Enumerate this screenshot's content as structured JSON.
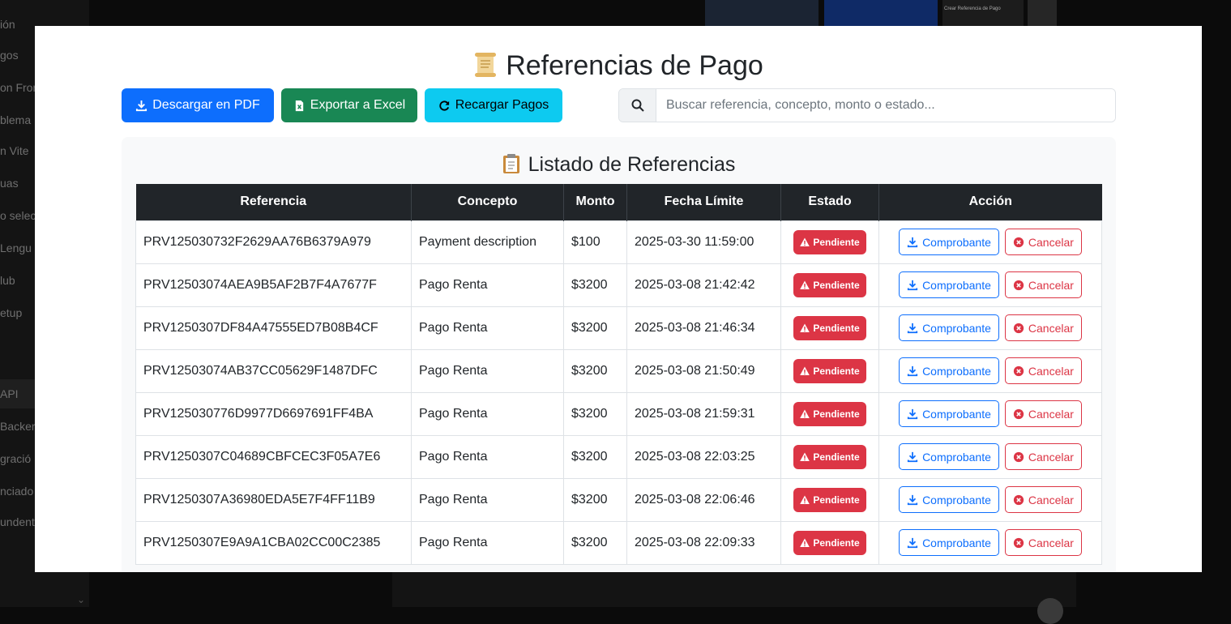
{
  "background": {
    "sidebar_items": [
      "ión",
      "gos",
      "on Fron",
      "blema",
      "n Vite",
      "uas",
      "o selec",
      "Lengu",
      "lub",
      "etup",
      "API",
      "Backer",
      "gració",
      "nciado",
      "undent"
    ],
    "thumb_text": "Crear Referencia de Pago"
  },
  "modal": {
    "title": "Referencias de Pago",
    "toolbar": {
      "pdf_label": "Descargar en PDF",
      "excel_label": "Exportar a Excel",
      "reload_label": "Recargar Pagos"
    },
    "search": {
      "value": "",
      "placeholder": "Buscar referencia, concepto, monto o estado..."
    },
    "list_title": "Listado de Referencias",
    "table": {
      "headers": [
        "Referencia",
        "Concepto",
        "Monto",
        "Fecha Límite",
        "Estado",
        "Acción"
      ],
      "rows": [
        {
          "ref": "PRV125030732F2629AA76B6379A979",
          "concepto": "Payment description",
          "monto": "$100",
          "fecha": "2025-03-30 11:59:00",
          "estado": "Pendiente"
        },
        {
          "ref": "PRV12503074AEA9B5AF2B7F4A7677F",
          "concepto": "Pago Renta",
          "monto": "$3200",
          "fecha": "2025-03-08 21:42:42",
          "estado": "Pendiente"
        },
        {
          "ref": "PRV1250307DF84A47555ED7B08B4CF",
          "concepto": "Pago Renta",
          "monto": "$3200",
          "fecha": "2025-03-08 21:46:34",
          "estado": "Pendiente"
        },
        {
          "ref": "PRV12503074AB37CC05629F1487DFC",
          "concepto": "Pago Renta",
          "monto": "$3200",
          "fecha": "2025-03-08 21:50:49",
          "estado": "Pendiente"
        },
        {
          "ref": "PRV125030776D9977D6697691FF4BA",
          "concepto": "Pago Renta",
          "monto": "$3200",
          "fecha": "2025-03-08 21:59:31",
          "estado": "Pendiente"
        },
        {
          "ref": "PRV1250307C04689CBFCEC3F05A7E6",
          "concepto": "Pago Renta",
          "monto": "$3200",
          "fecha": "2025-03-08 22:03:25",
          "estado": "Pendiente"
        },
        {
          "ref": "PRV1250307A36980EDA5E7F4FF11B9",
          "concepto": "Pago Renta",
          "monto": "$3200",
          "fecha": "2025-03-08 22:06:46",
          "estado": "Pendiente"
        },
        {
          "ref": "PRV1250307E9A9A1CBA02CC00C2385",
          "concepto": "Pago Renta",
          "monto": "$3200",
          "fecha": "2025-03-08 22:09:33",
          "estado": "Pendiente"
        }
      ],
      "action_labels": {
        "receipt": "Comprobante",
        "cancel": "Cancelar"
      }
    },
    "colors": {
      "primary": "#0d6efd",
      "success": "#198754",
      "info": "#0dcaf0",
      "danger": "#dc3545",
      "table_header": "#212529"
    },
    "icons": {
      "title": "scroll-icon",
      "list": "clipboard-icon",
      "pdf": "download-icon",
      "excel": "excel-file-icon",
      "reload": "reload-icon",
      "search": "search-icon",
      "badge": "warning-icon",
      "receipt": "download-icon",
      "cancel": "x-circle-icon"
    }
  }
}
